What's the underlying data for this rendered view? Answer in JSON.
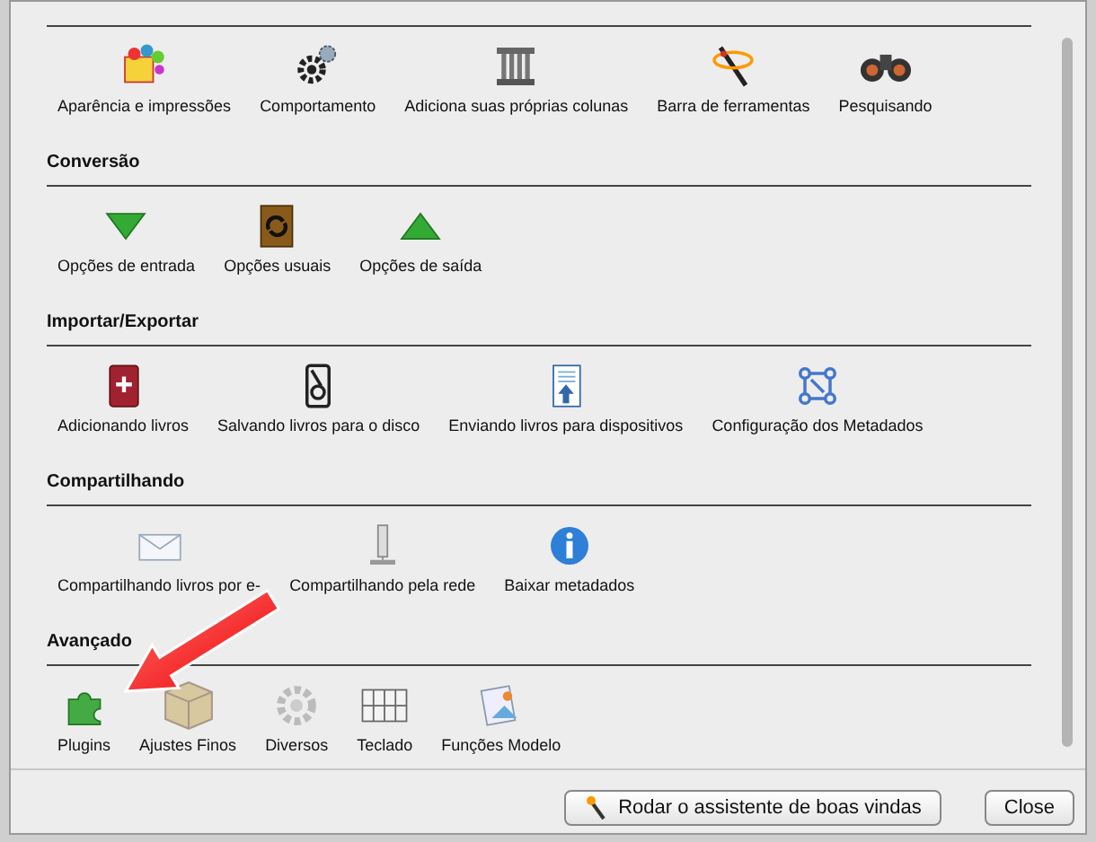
{
  "sections": [
    {
      "items": [
        {
          "label": "Aparência e impressões"
        },
        {
          "label": "Comportamento"
        },
        {
          "label": "Adiciona suas próprias colunas"
        },
        {
          "label": "Barra de ferramentas"
        },
        {
          "label": "Pesquisando"
        }
      ]
    },
    {
      "title": "Conversão",
      "items": [
        {
          "label": "Opções de entrada"
        },
        {
          "label": "Opções usuais"
        },
        {
          "label": "Opções de saída"
        }
      ]
    },
    {
      "title": "Importar/Exportar",
      "items": [
        {
          "label": "Adicionando livros"
        },
        {
          "label": "Salvando livros para o disco"
        },
        {
          "label": "Enviando livros para dispositivos"
        },
        {
          "label": "Configuração dos Metadados"
        }
      ]
    },
    {
      "title": "Compartilhando",
      "items": [
        {
          "label": "Compartilhando livros por e-"
        },
        {
          "label": "Compartilhando pela rede"
        },
        {
          "label": "Baixar metadados"
        }
      ]
    },
    {
      "title": "Avançado",
      "items": [
        {
          "label": "Plugins"
        },
        {
          "label": "Ajustes Finos"
        },
        {
          "label": "Diversos"
        },
        {
          "label": "Teclado"
        },
        {
          "label": "Funções Modelo"
        }
      ]
    }
  ],
  "buttons": [
    {
      "label": "Rodar o assistente de boas vindas",
      "kind": "wizard"
    },
    {
      "label": "Close",
      "kind": "plain"
    }
  ]
}
